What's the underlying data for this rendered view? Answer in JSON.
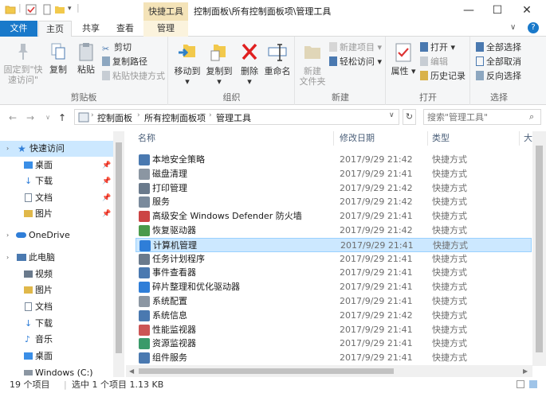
{
  "window": {
    "context_tab": "快捷工具",
    "title": "控制面板\\所有控制面板项\\管理工具",
    "minimize": "—",
    "maximize": "☐",
    "close": "✕"
  },
  "tabs": [
    "文件",
    "主页",
    "共享",
    "查看",
    "管理"
  ],
  "ribbon": {
    "clipboard": {
      "label": "剪贴板",
      "pin": "固定到\"快速访问\"",
      "copy": "复制",
      "paste": "粘贴",
      "cut": "剪切",
      "copy_path": "复制路径",
      "paste_shortcut": "粘贴快捷方式"
    },
    "organize": {
      "label": "组织",
      "move_to": "移动到",
      "copy_to": "复制到",
      "delete": "删除",
      "rename": "重命名"
    },
    "new": {
      "label": "新建",
      "new_folder": "新建\n文件夹",
      "new_item": "新建项目",
      "easy_access": "轻松访问"
    },
    "open": {
      "label": "打开",
      "properties": "属性",
      "open": "打开",
      "edit": "编辑",
      "history": "历史记录"
    },
    "select": {
      "label": "选择",
      "select_all": "全部选择",
      "select_none": "全部取消",
      "invert": "反向选择"
    }
  },
  "address": {
    "crumbs": [
      "控制面板",
      "所有控制面板项",
      "管理工具"
    ],
    "search_placeholder": "搜索\"管理工具\""
  },
  "navpane": {
    "quick_access": "快速访问",
    "quick_items": [
      "桌面",
      "下载",
      "文档",
      "图片"
    ],
    "onedrive": "OneDrive",
    "this_pc": "此电脑",
    "pc_items": [
      "视频",
      "图片",
      "文档",
      "下载",
      "音乐",
      "桌面",
      "Windows (C:)"
    ]
  },
  "columns": {
    "name": "名称",
    "date": "修改日期",
    "type": "类型",
    "size": "大"
  },
  "files": [
    {
      "name": "本地安全策略",
      "date": "2017/9/29 21:42",
      "type": "快捷方式"
    },
    {
      "name": "磁盘清理",
      "date": "2017/9/29 21:41",
      "type": "快捷方式"
    },
    {
      "name": "打印管理",
      "date": "2017/9/29 21:42",
      "type": "快捷方式"
    },
    {
      "name": "服务",
      "date": "2017/9/29 21:42",
      "type": "快捷方式"
    },
    {
      "name": "高级安全 Windows Defender 防火墙",
      "date": "2017/9/29 21:41",
      "type": "快捷方式"
    },
    {
      "name": "恢复驱动器",
      "date": "2017/9/29 21:42",
      "type": "快捷方式"
    },
    {
      "name": "计算机管理",
      "date": "2017/9/29 21:41",
      "type": "快捷方式"
    },
    {
      "name": "任务计划程序",
      "date": "2017/9/29 21:41",
      "type": "快捷方式"
    },
    {
      "name": "事件查看器",
      "date": "2017/9/29 21:41",
      "type": "快捷方式"
    },
    {
      "name": "碎片整理和优化驱动器",
      "date": "2017/9/29 21:41",
      "type": "快捷方式"
    },
    {
      "name": "系统配置",
      "date": "2017/9/29 21:41",
      "type": "快捷方式"
    },
    {
      "name": "系统信息",
      "date": "2017/9/29 21:42",
      "type": "快捷方式"
    },
    {
      "name": "性能监视器",
      "date": "2017/9/29 21:41",
      "type": "快捷方式"
    },
    {
      "name": "资源监视器",
      "date": "2017/9/29 21:41",
      "type": "快捷方式"
    },
    {
      "name": "组件服务",
      "date": "2017/9/29 21:41",
      "type": "快捷方式"
    }
  ],
  "status": {
    "count": "19 个项目",
    "selection": "选中 1 个项目  1.13 KB"
  },
  "colors": {
    "accent": "#1979ca",
    "selection": "#cce8ff",
    "context_tab": "#f4e3b8"
  }
}
